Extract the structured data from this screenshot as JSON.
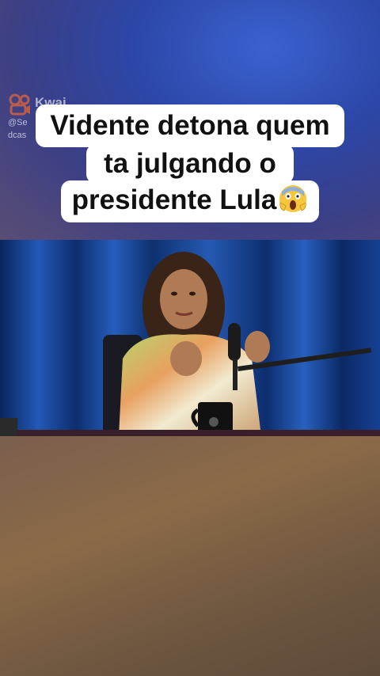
{
  "watermark": {
    "brand": "Kwai",
    "handle_line1": "@Se",
    "handle_line2": "dcas",
    "icon": "kwai-logo-icon"
  },
  "caption": {
    "line1": "Vidente detona quem",
    "line2": "ta julgando o",
    "line3": "presidente Lula",
    "emoji": "screaming-face-emoji"
  },
  "video": {
    "description_icon": "podcast-studio-frame"
  },
  "colors": {
    "caption_bg": "#ffffff",
    "caption_text": "#111111",
    "curtain_blue": "#1d4fb8"
  }
}
